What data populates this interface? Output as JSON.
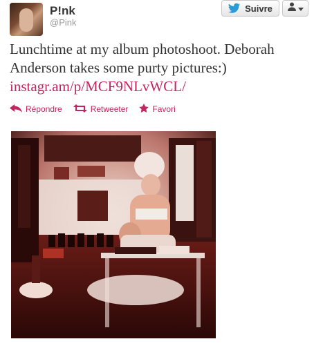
{
  "user": {
    "name": "P!nk",
    "handle": "@Pink"
  },
  "buttons": {
    "follow_label": "Suivre",
    "follow_icon": "twitter-bird-icon",
    "user_menu_icon": "person-icon"
  },
  "tweet": {
    "text": "Lunchtime at my album photoshoot. Deborah Anderson takes some purty pictures:)",
    "link": "instagr.am/p/MCF9NLvWCL/"
  },
  "actions": [
    {
      "label": "Répondre",
      "icon": "reply-icon"
    },
    {
      "label": "Retweeter",
      "icon": "retweet-icon"
    },
    {
      "label": "Favori",
      "icon": "star-icon"
    }
  ],
  "colors": {
    "link": "#c02660",
    "accent_blue": "#2b9bd6"
  }
}
